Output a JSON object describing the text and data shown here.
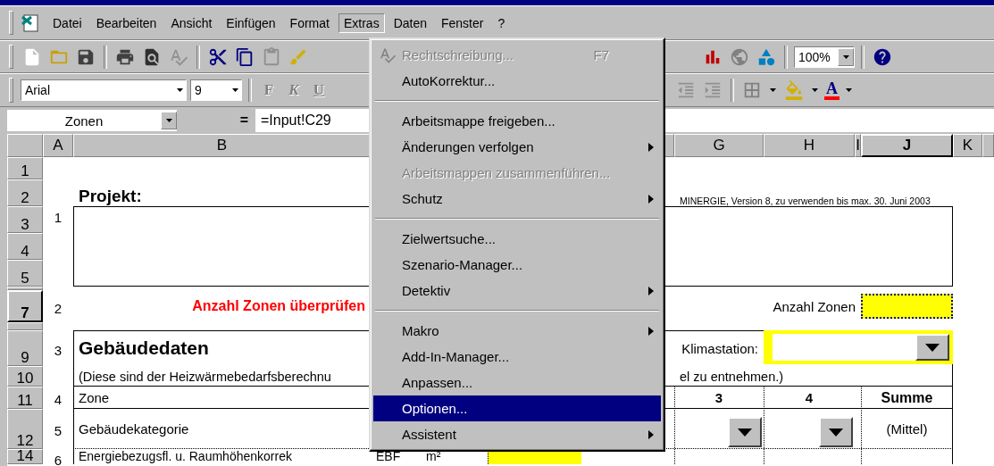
{
  "menu_bar": {
    "items": [
      {
        "label": "Datei",
        "selected": false
      },
      {
        "label": "Bearbeiten",
        "selected": false
      },
      {
        "label": "Ansicht",
        "selected": false
      },
      {
        "label": "Einfügen",
        "selected": false
      },
      {
        "label": "Format",
        "selected": false
      },
      {
        "label": "Extras",
        "selected": true
      },
      {
        "label": "Daten",
        "selected": false
      },
      {
        "label": "Fenster",
        "selected": false
      },
      {
        "label": "?",
        "selected": false
      }
    ]
  },
  "standard_toolbar": {
    "zoom": "100%"
  },
  "format_toolbar": {
    "font": "Arial",
    "size": "9",
    "bold": "F",
    "italic": "K",
    "underline": "U",
    "font_color": "A"
  },
  "formula_bar": {
    "name_box": "Zonen",
    "equals": "=",
    "formula": "=Input!C29"
  },
  "extras_menu": [
    {
      "kind": "item",
      "label": "Rechtschreibung...",
      "shortcut": "F7",
      "disabled": true,
      "selected": false,
      "submenu": false
    },
    {
      "kind": "item",
      "label": "AutoKorrektur...",
      "disabled": false,
      "selected": false,
      "submenu": false
    },
    {
      "kind": "separator"
    },
    {
      "kind": "item",
      "label": "Arbeitsmappe freigeben...",
      "disabled": false,
      "selected": false,
      "submenu": false
    },
    {
      "kind": "item",
      "label": "Änderungen verfolgen",
      "disabled": false,
      "selected": false,
      "submenu": true
    },
    {
      "kind": "item",
      "label": "Arbeitsmappen zusammenführen...",
      "disabled": true,
      "selected": false,
      "submenu": false
    },
    {
      "kind": "item",
      "label": "Schutz",
      "disabled": false,
      "selected": false,
      "submenu": true
    },
    {
      "kind": "separator"
    },
    {
      "kind": "item",
      "label": "Zielwertsuche...",
      "disabled": false,
      "selected": false,
      "submenu": false
    },
    {
      "kind": "item",
      "label": "Szenario-Manager...",
      "disabled": false,
      "selected": false,
      "submenu": false
    },
    {
      "kind": "item",
      "label": "Detektiv",
      "disabled": false,
      "selected": false,
      "submenu": true
    },
    {
      "kind": "separator"
    },
    {
      "kind": "item",
      "label": "Makro",
      "disabled": false,
      "selected": false,
      "submenu": true
    },
    {
      "kind": "item",
      "label": "Add-In-Manager...",
      "disabled": false,
      "selected": false,
      "submenu": false
    },
    {
      "kind": "item",
      "label": "Anpassen...",
      "disabled": false,
      "selected": false,
      "submenu": false
    },
    {
      "kind": "item",
      "label": "Optionen...",
      "disabled": false,
      "selected": true,
      "submenu": false
    },
    {
      "kind": "item",
      "label": "Assistent",
      "disabled": false,
      "selected": false,
      "submenu": true
    }
  ],
  "columns": [
    {
      "label": "A",
      "selected": false
    },
    {
      "label": "B",
      "selected": false
    },
    {
      "label": "G",
      "selected": false
    },
    {
      "label": "H",
      "selected": false
    },
    {
      "label": "I",
      "selected": false
    },
    {
      "label": "J",
      "selected": true
    },
    {
      "label": "K",
      "selected": false
    }
  ],
  "row_headers": [
    {
      "label": "1",
      "selected": false
    },
    {
      "label": "2",
      "selected": false
    },
    {
      "label": "3",
      "selected": false
    },
    {
      "label": "4",
      "selected": false
    },
    {
      "label": "5",
      "selected": false
    },
    {
      "selected": false
    },
    {
      "label": "7",
      "selected": true
    },
    {
      "selected": false
    },
    {
      "label": "9",
      "selected": false
    },
    {
      "label": "10",
      "selected": false
    },
    {
      "label": "11",
      "selected": false
    },
    {
      "label": "12",
      "selected": false
    },
    {
      "label": "14",
      "selected": false
    }
  ],
  "sheet": {
    "project_label": "Projekt:",
    "version_note": "MINERGIE, Version 8, zu verwenden bis max. 30. Juni 2003",
    "project_number": "1",
    "warning_number": "2",
    "warning": "Anzahl Zonen überprüfen",
    "zone_count_label": "Anzahl Zonen",
    "section_number": "3",
    "section_title": "Gebäudedaten",
    "climate_label": "Klimastation:",
    "note": "(Diese sind der Heizwärmebedarfsberechnu",
    "note_end": "el zu entnehmen.)",
    "zone_row": {
      "number": "4",
      "label": "Zone",
      "zone_3": "3",
      "zone_4": "4",
      "total": "Summe"
    },
    "category_row": {
      "number": "5",
      "label": "Gebäudekategorie",
      "average": "(Mittel)"
    },
    "area_row": {
      "number": "6",
      "label": "Energiebezugsfl. u. Raumhöhenkorrek",
      "abbr": "EBF",
      "unit": "m²"
    }
  }
}
